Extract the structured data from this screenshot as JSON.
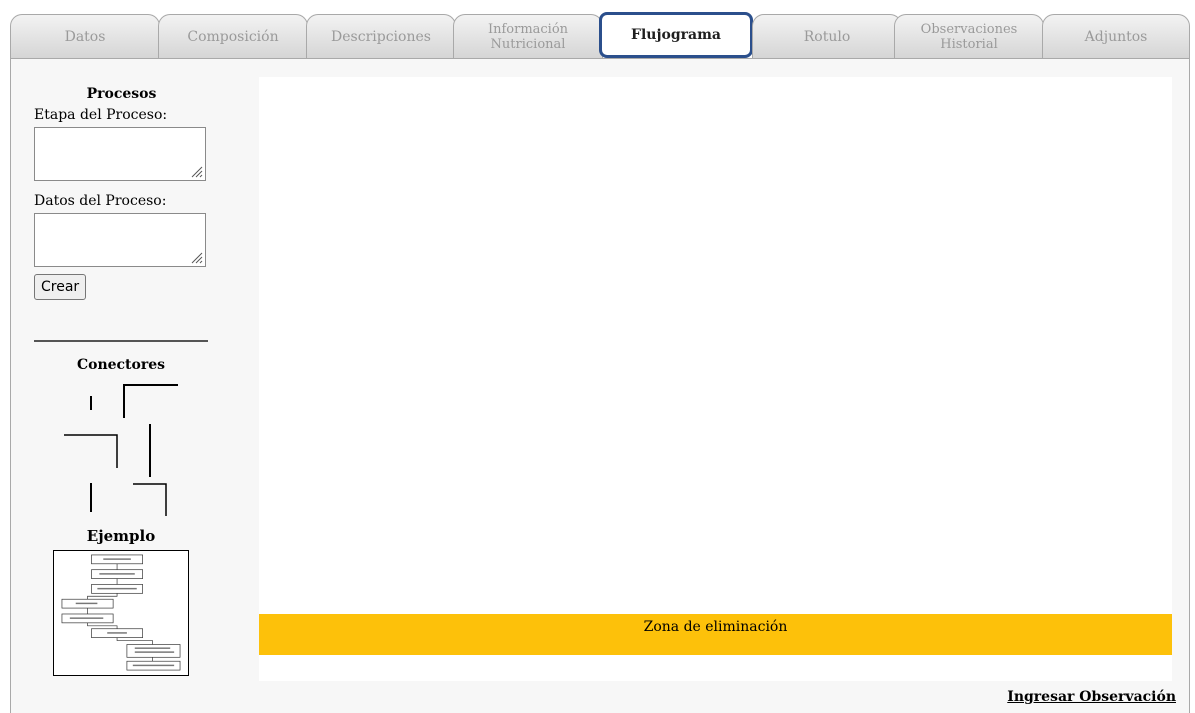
{
  "tabs": [
    {
      "id": "datos",
      "lines": [
        "Datos"
      ]
    },
    {
      "id": "composicion",
      "lines": [
        "Composición"
      ]
    },
    {
      "id": "descripciones",
      "lines": [
        "Descripciones"
      ]
    },
    {
      "id": "informacion-nutricional",
      "lines": [
        "Información",
        "Nutricional"
      ]
    },
    {
      "id": "flujograma",
      "lines": [
        "Flujograma"
      ],
      "active": true
    },
    {
      "id": "rotulo",
      "lines": [
        "Rotulo"
      ]
    },
    {
      "id": "observaciones-historial",
      "lines": [
        "Observaciones",
        "Historial"
      ]
    },
    {
      "id": "adjuntos",
      "lines": [
        "Adjuntos"
      ]
    }
  ],
  "sidebar": {
    "procesos_title": "Procesos",
    "etapa_label": "Etapa del Proceso:",
    "etapa_value": "",
    "datos_label": "Datos del Proceso:",
    "datos_value": "",
    "crear_label": "Crear",
    "conectores_title": "Conectores",
    "ejemplo_title": "Ejemplo"
  },
  "canvas": {
    "trash_label": "Zona de eliminación"
  },
  "footer": {
    "observacion_link": "Ingresar Observación"
  },
  "colors": {
    "active_tab_border": "#2b4f8c",
    "trash_zone": "#fdc10a"
  }
}
